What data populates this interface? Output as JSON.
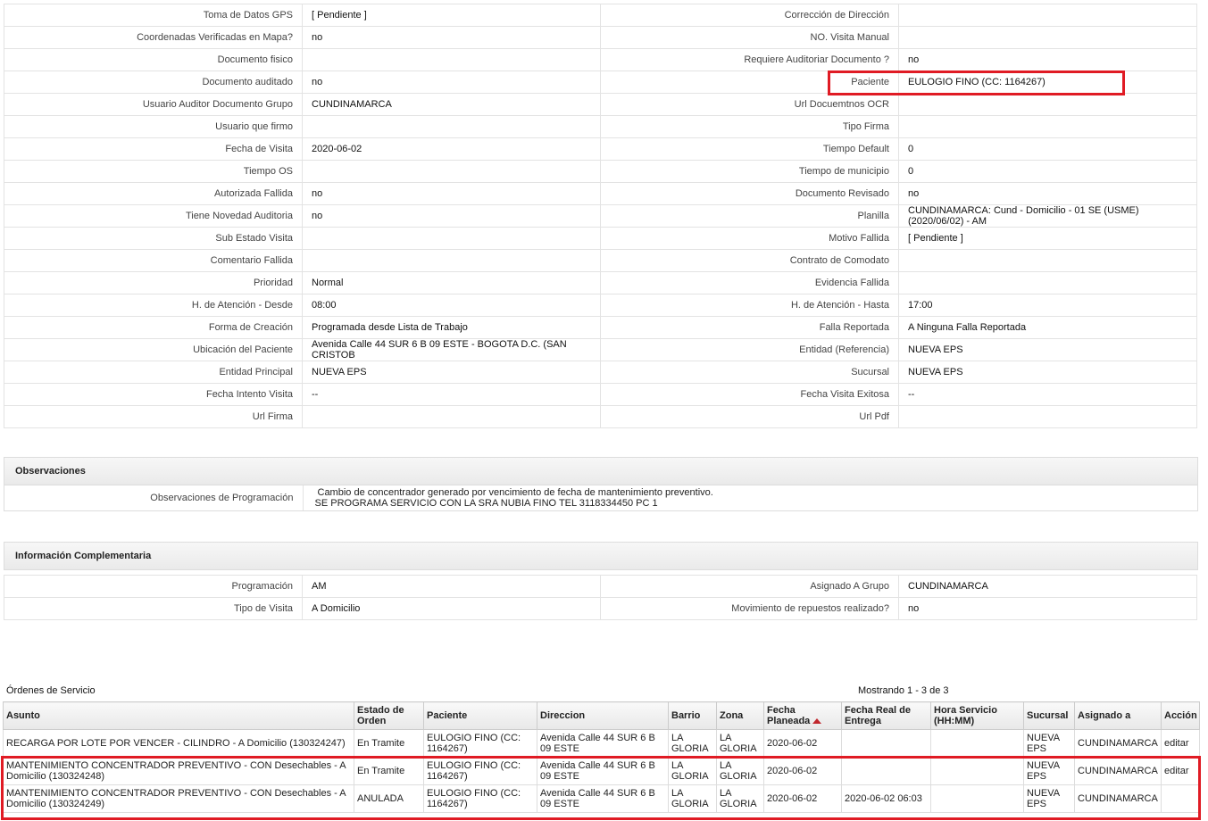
{
  "details": [
    {
      "l1": "Toma de Datos GPS",
      "v1": "[ Pendiente ]",
      "l2": "Corrección de Dirección",
      "v2": ""
    },
    {
      "l1": "Coordenadas Verificadas en Mapa?",
      "v1": "no",
      "l2": "NO. Visita Manual",
      "v2": ""
    },
    {
      "l1": "Documento fisico",
      "v1": "",
      "l2": "Requiere Auditoriar Documento ?",
      "v2": "no"
    },
    {
      "l1": "Documento auditado",
      "v1": "no",
      "l2": "Paciente",
      "v2": "EULOGIO FINO (CC: 1164267)"
    },
    {
      "l1": "Usuario Auditor Documento Grupo",
      "v1": "CUNDINAMARCA",
      "l2": "Url Docuemtnos OCR",
      "v2": ""
    },
    {
      "l1": "Usuario que firmo",
      "v1": "",
      "l2": "Tipo Firma",
      "v2": ""
    },
    {
      "l1": "Fecha de Visita",
      "v1": "2020-06-02",
      "l2": "Tiempo Default",
      "v2": "0"
    },
    {
      "l1": "Tiempo OS",
      "v1": "",
      "l2": "Tiempo de municipio",
      "v2": "0"
    },
    {
      "l1": "Autorizada Fallida",
      "v1": "no",
      "l2": "Documento Revisado",
      "v2": "no"
    },
    {
      "l1": "Tiene Novedad Auditoria",
      "v1": "no",
      "l2": "Planilla",
      "v2": "CUNDINAMARCA: Cund - Domicilio - 01 SE (USME) (2020/06/02) - AM"
    },
    {
      "l1": "Sub Estado Visita",
      "v1": "",
      "l2": "Motivo Fallida",
      "v2": "[ Pendiente ]"
    },
    {
      "l1": "Comentario Fallida",
      "v1": "",
      "l2": "Contrato de Comodato",
      "v2": ""
    },
    {
      "l1": "Prioridad",
      "v1": "Normal",
      "l2": "Evidencia Fallida",
      "v2": ""
    },
    {
      "l1": "H. de Atención - Desde",
      "v1": "08:00",
      "l2": "H. de Atención - Hasta",
      "v2": "17:00"
    },
    {
      "l1": "Forma de Creación",
      "v1": "Programada desde Lista de Trabajo",
      "l2": "Falla Reportada",
      "v2": "A Ninguna Falla Reportada"
    },
    {
      "l1": "Ubicación del Paciente",
      "v1": "Avenida Calle 44 SUR 6 B 09 ESTE - BOGOTA D.C. (SAN CRISTOB",
      "l2": "Entidad (Referencia)",
      "v2": "NUEVA EPS"
    },
    {
      "l1": "Entidad Principal",
      "v1": "NUEVA EPS",
      "l2": "Sucursal",
      "v2": "NUEVA EPS"
    },
    {
      "l1": "Fecha Intento Visita",
      "v1": "--",
      "l2": "Fecha Visita Exitosa",
      "v2": "--"
    },
    {
      "l1": "Url Firma",
      "v1": "",
      "l2": "Url Pdf",
      "v2": ""
    }
  ],
  "observaciones": {
    "title": "Observaciones",
    "label": "Observaciones de Programación",
    "line1": "Cambio de concentrador generado por vencimiento de fecha de mantenimiento preventivo.",
    "line2": "SE PROGRAMA SERVICIO CON LA SRA NUBIA FINO TEL 3118334450 PC 1"
  },
  "complementaria": {
    "title": "Información Complementaria",
    "rows": [
      {
        "l1": "Programación",
        "v1": "AM",
        "l2": "Asignado A Grupo",
        "v2": "CUNDINAMARCA"
      },
      {
        "l1": "Tipo de Visita",
        "v1": "A Domicilio",
        "l2": "Movimiento de repuestos realizado?",
        "v2": "no"
      }
    ]
  },
  "orders": {
    "title": "Órdenes de Servicio",
    "showing": "Mostrando 1 - 3 de 3",
    "columns": [
      "Asunto",
      "Estado de Orden",
      "Paciente",
      "Direccion",
      "Barrio",
      "Zona",
      "Fecha Planeada",
      "Fecha Real de Entrega",
      "Hora Servicio (HH:MM)",
      "Sucursal",
      "Asignado a",
      "Acción"
    ],
    "rows": [
      {
        "asunto": "RECARGA POR LOTE POR VENCER - CILINDRO - A Domicilio (130324247)",
        "estado": "En Tramite",
        "paciente": "EULOGIO FINO (CC: 1164267)",
        "direccion": "Avenida Calle 44 SUR 6 B 09 ESTE",
        "barrio": "LA GLORIA",
        "zona": "LA GLORIA",
        "fecha_planeada": "2020-06-02",
        "fecha_real": "",
        "hora": "",
        "sucursal": "NUEVA EPS",
        "asignado": "CUNDINAMARCA",
        "accion": "editar"
      },
      {
        "asunto": "MANTENIMIENTO CONCENTRADOR PREVENTIVO - CON Desechables - A Domicilio (130324248)",
        "estado": "En Tramite",
        "paciente": "EULOGIO FINO (CC: 1164267)",
        "direccion": "Avenida Calle 44 SUR 6 B 09 ESTE",
        "barrio": "LA GLORIA",
        "zona": "LA GLORIA",
        "fecha_planeada": "2020-06-02",
        "fecha_real": "",
        "hora": "",
        "sucursal": "NUEVA EPS",
        "asignado": "CUNDINAMARCA",
        "accion": "editar"
      },
      {
        "asunto": "MANTENIMIENTO CONCENTRADOR PREVENTIVO - CON Desechables - A Domicilio (130324249)",
        "estado": "ANULADA",
        "paciente": "EULOGIO FINO (CC: 1164267)",
        "direccion": "Avenida Calle 44 SUR 6 B 09 ESTE",
        "barrio": "LA GLORIA",
        "zona": "LA GLORIA",
        "fecha_planeada": "2020-06-02",
        "fecha_real": "2020-06-02 06:03",
        "hora": "",
        "sucursal": "NUEVA EPS",
        "asignado": "CUNDINAMARCA",
        "accion": ""
      }
    ]
  },
  "highlight_color": "#e01b24"
}
